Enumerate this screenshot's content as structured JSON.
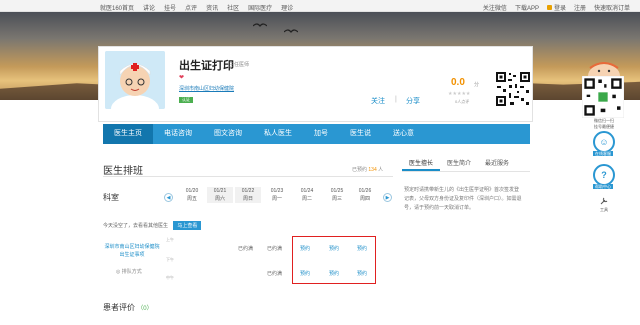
{
  "topbar": {
    "links": [
      "就医160首页",
      "讲论",
      "挂号",
      "点评",
      "资讯",
      "社区",
      "国际医疗",
      "理诊"
    ],
    "follow_wechat": "关注微信",
    "download_app": "下载APP",
    "login": "登录",
    "register": "注册",
    "quick_cancel": "快速取消订单"
  },
  "doctor": {
    "name": "出生证打印",
    "title": "主任医师",
    "hospital": "深圳市南山区妇幼保健院",
    "badge": "认证",
    "follow": "关注",
    "divider": "|",
    "share": "分享",
    "score": "0.0",
    "score_unit": "分",
    "stars": "★★★★★",
    "reviewers": "0人点评"
  },
  "nav": {
    "items": [
      "医生主页",
      "电话咨询",
      "图文咨询",
      "私人医生",
      "加号",
      "医生说",
      "送心意"
    ]
  },
  "schedule": {
    "title": "医生排班",
    "count_prefix": "已预约",
    "count": "134",
    "count_suffix": "人",
    "department": "科室",
    "dates": [
      {
        "date": "01/20",
        "weekday": "周五"
      },
      {
        "date": "01/21",
        "weekday": "周六"
      },
      {
        "date": "01/22",
        "weekday": "周日"
      },
      {
        "date": "01/23",
        "weekday": "周一"
      },
      {
        "date": "01/24",
        "weekday": "周二"
      },
      {
        "date": "01/25",
        "weekday": "周三"
      },
      {
        "date": "01/26",
        "weekday": "周四"
      }
    ],
    "tip_text": "今天没空了，去看看其他医生",
    "tip_button": "马上查看",
    "row_hospital": "深圳市南山区妇幼保健院出生证事项",
    "row_sub": "◎ 排队方式",
    "shifts": [
      "上午",
      "下午",
      "中午"
    ],
    "full_label": "已约满",
    "book_label": "预约"
  },
  "side": {
    "tabs": [
      "医生擅长",
      "医生简介",
      "最近服务"
    ],
    "text": "预定时请携带新生儿的《出生医学证明》首次签发登记表，父母双方身份证及复印件（深圳户口）。如需退号，请于预约前一天取消订单。"
  },
  "reviews": {
    "title": "患者评价",
    "count": "（0）"
  },
  "float": {
    "caption": "微信扫一扫\n挂号最便捷",
    "online_service": "在线客服",
    "help_center": "帮助中心",
    "tools": "工具"
  },
  "colors": {
    "accent": "#2a97d2",
    "nav_active": "#1276ad",
    "highlight_box": "#e02020",
    "score": "#f29100"
  }
}
